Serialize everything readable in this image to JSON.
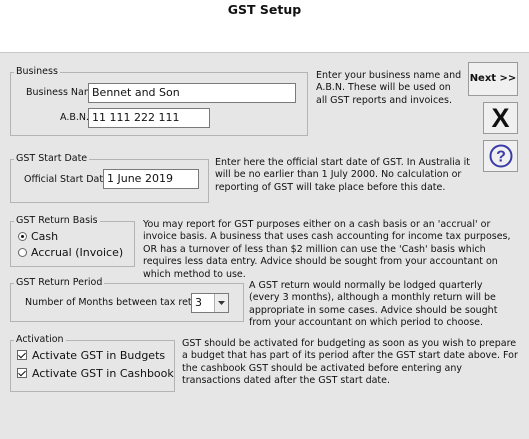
{
  "window": {
    "title": "GST Setup"
  },
  "business": {
    "legend": "Business",
    "name_label": "Business Name",
    "name_value": "Bennet and Son",
    "abn_label": "A.B.N.",
    "abn_value": "11 111 222 111",
    "help": "Enter your business name and A.B.N. These will be used on all GST reports and invoices."
  },
  "start_date": {
    "legend": "GST Start Date",
    "label": "Official Start Date",
    "value": "1 June 2019",
    "help": "Enter here the official start date of GST. In Australia it will be no earlier than 1 July 2000. No calculation or reporting of GST will take place before this date."
  },
  "return_basis": {
    "legend": "GST Return Basis",
    "options": [
      {
        "label": "Cash",
        "selected": true
      },
      {
        "label": "Accrual (Invoice)",
        "selected": false
      }
    ],
    "help": "You may report for GST purposes either on a cash basis or an 'accrual' or invoice basis. A business that uses cash accounting for income tax purposes, OR has a turnover of less than $2 million can use the 'Cash' basis which requires less data entry. Advice should be sought from your accountant on which method to use."
  },
  "return_period": {
    "legend": "GST Return Period",
    "label": "Number of Months between tax returns",
    "value": "3",
    "help": "A GST return would normally be lodged quarterly (every 3 months), although a monthly return will be appropriate in some cases. Advice should be sought from your accountant on which period to choose."
  },
  "activation": {
    "legend": "Activation",
    "options": [
      {
        "label": "Activate GST in Budgets",
        "checked": true
      },
      {
        "label": "Activate GST in Cashbook",
        "checked": true
      }
    ],
    "help": "GST should be activated for budgeting as soon as you wish to prepare a budget that has part of its period after the GST start date above. For the cashbook GST should be activated before entering any transactions dated after the GST start date."
  },
  "buttons": {
    "next_label": "Next >>",
    "close_icon": "close-x-icon",
    "help_icon": "question-mark-icon"
  }
}
